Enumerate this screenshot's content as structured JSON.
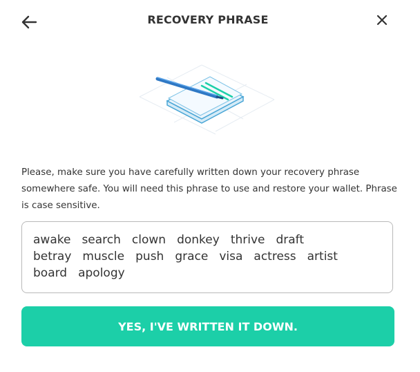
{
  "header": {
    "title": "RECOVERY PHRASE",
    "back_icon": "arrow-left-icon",
    "close_icon": "close-icon"
  },
  "illustration": {
    "icon": "notepad-with-pen-icon"
  },
  "description": "Please, make sure you have carefully written down your recovery phrase somewhere safe. You will need this phrase to use and restore your wallet. Phrase is case sensitive.",
  "phrase": {
    "words": [
      "awake",
      "search",
      "clown",
      "donkey",
      "thrive",
      "draft",
      "betray",
      "muscle",
      "push",
      "grace",
      "visa",
      "actress",
      "artist",
      "board",
      "apology"
    ]
  },
  "confirm_button": {
    "label": "YES, I'VE WRITTEN IT DOWN."
  },
  "colors": {
    "accent": "#1ccfa8",
    "text": "#333333",
    "border": "#b9b9b9"
  }
}
